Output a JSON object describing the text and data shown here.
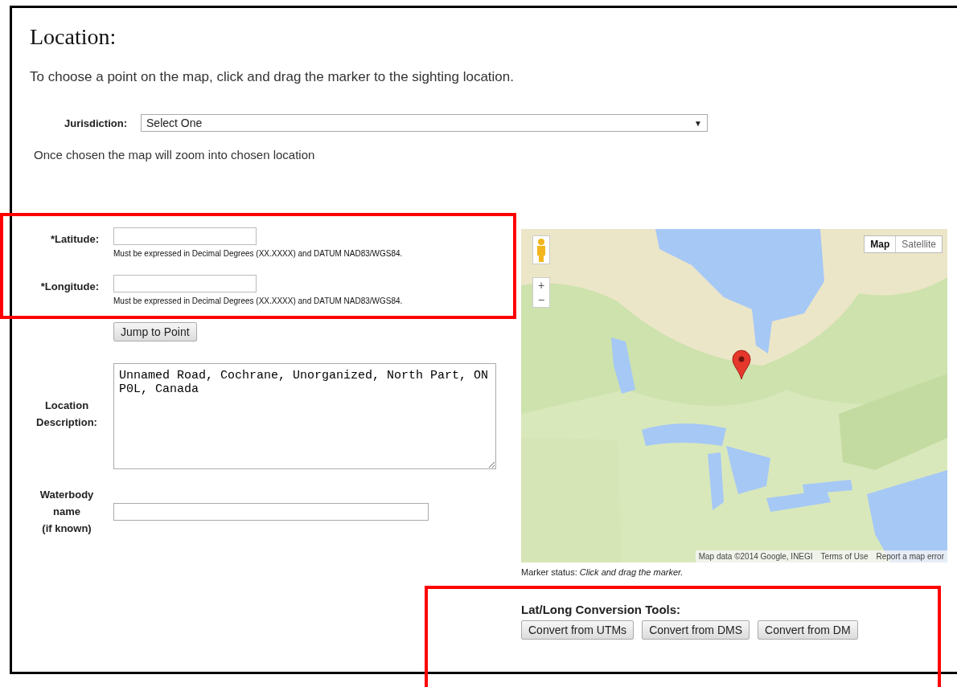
{
  "page": {
    "title": "Location:",
    "instruction": "To choose a point on the map, click and drag the marker to the sighting location."
  },
  "jurisdiction": {
    "label": "Jurisdiction:",
    "value": "Select One",
    "caret": "▼",
    "note": "Once chosen the map will zoom into chosen location"
  },
  "fields": [
    {
      "kind": "text",
      "label": "*Latitude:",
      "hint": "Must be expressed in Decimal Degrees (XX.XXXX) and DATUM NAD83/WGS84."
    },
    {
      "kind": "text",
      "label": "*Longitude:",
      "hint": "Must be expressed in Decimal Degrees (XX.XXXX) and DATUM NAD83/WGS84."
    },
    {
      "kind": "button",
      "label": "Jump to Point"
    },
    {
      "kind": "textarea",
      "label": "Location Description:",
      "value": "Unnamed Road, Cochrane, Unorganized, North Part, ON P0L, Canada"
    },
    {
      "kind": "wide",
      "label": "Waterbody\nname\n(if known)"
    }
  ],
  "map": {
    "map_types": [
      {
        "label": "Map",
        "selected": true
      },
      {
        "label": "Satellite",
        "selected": false
      }
    ],
    "zoom_in": "+",
    "zoom_out": "−",
    "attribution": [
      "Map data ©2014 Google, INEGI",
      "Terms of Use",
      "Report a map error"
    ],
    "marker_status": "Marker status: *Click and drag the marker.*"
  },
  "conversion": {
    "title": "Lat/Long Conversion Tools:",
    "buttons": [
      "Convert from UTMs",
      "Convert from DMS",
      "Convert from DM"
    ]
  }
}
